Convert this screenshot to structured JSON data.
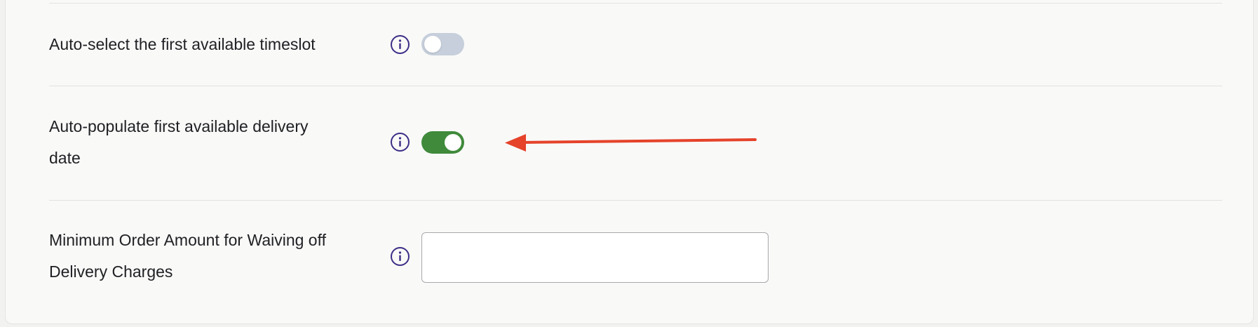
{
  "settings": {
    "auto_select_timeslot": {
      "label": "Auto-select the first available timeslot",
      "enabled": false
    },
    "auto_populate_delivery_date": {
      "label_line1": "Auto-populate first available delivery",
      "label_line2": "date",
      "enabled": true
    },
    "min_order_amount": {
      "label_line1": "Minimum Order Amount for Waiving off",
      "label_line2": "Delivery Charges",
      "value": ""
    }
  },
  "colors": {
    "toggle_on": "#3f8a3b",
    "toggle_off": "#c6cfdb",
    "info_icon": "#3b2e86",
    "annotation_arrow": "#e5432a"
  },
  "icons": {
    "info": "info-circle-icon",
    "arrow": "annotation-arrow-left"
  }
}
